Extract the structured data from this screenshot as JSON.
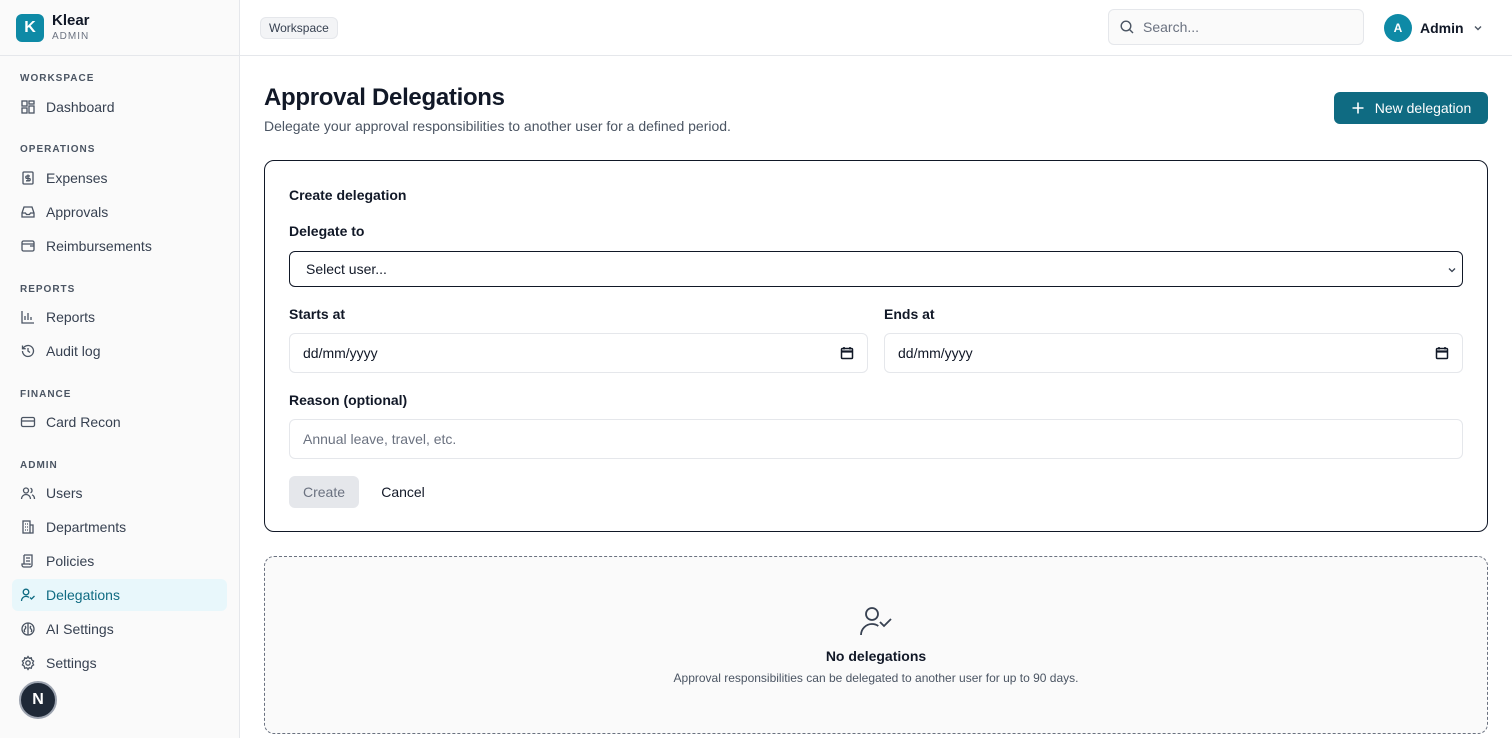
{
  "brand": {
    "logo_letter": "K",
    "name": "Klear",
    "subtitle": "ADMIN",
    "accent": "#0e8aa6"
  },
  "sidebar": {
    "sections": [
      {
        "label": "WORKSPACE",
        "items": [
          {
            "label": "Dashboard",
            "icon": "dashboard-icon"
          }
        ]
      },
      {
        "label": "OPERATIONS",
        "items": [
          {
            "label": "Expenses",
            "icon": "receipt-icon"
          },
          {
            "label": "Approvals",
            "icon": "inbox-icon"
          },
          {
            "label": "Reimbursements",
            "icon": "wallet-icon"
          }
        ]
      },
      {
        "label": "REPORTS",
        "items": [
          {
            "label": "Reports",
            "icon": "bar-chart-icon"
          },
          {
            "label": "Audit log",
            "icon": "history-icon"
          }
        ]
      },
      {
        "label": "FINANCE",
        "items": [
          {
            "label": "Card Recon",
            "icon": "credit-card-icon"
          }
        ]
      },
      {
        "label": "ADMIN",
        "items": [
          {
            "label": "Users",
            "icon": "users-icon"
          },
          {
            "label": "Departments",
            "icon": "building-icon"
          },
          {
            "label": "Policies",
            "icon": "scroll-icon"
          },
          {
            "label": "Delegations",
            "icon": "user-check-icon",
            "active": true
          },
          {
            "label": "AI Settings",
            "icon": "brain-icon"
          },
          {
            "label": "Settings",
            "icon": "gear-icon"
          }
        ]
      }
    ],
    "fab_letter": "N"
  },
  "topbar": {
    "breadcrumb": "Workspace",
    "search_placeholder": "Search...",
    "user": {
      "initial": "A",
      "name": "Admin"
    }
  },
  "page": {
    "title": "Approval Delegations",
    "subtitle": "Delegate your approval responsibilities to another user for a defined period.",
    "new_button": "New delegation"
  },
  "form": {
    "title": "Create delegation",
    "delegate_label": "Delegate to",
    "delegate_value": "Select user...",
    "starts_label": "Starts at",
    "starts_value": "dd/mm/yyyy",
    "ends_label": "Ends at",
    "ends_value": "dd/mm/yyyy",
    "reason_label": "Reason (optional)",
    "reason_placeholder": "Annual leave, travel, etc.",
    "create_button": "Create",
    "cancel_button": "Cancel"
  },
  "empty_state": {
    "title": "No delegations",
    "subtitle": "Approval responsibilities can be delegated to another user for up to 90 days."
  }
}
